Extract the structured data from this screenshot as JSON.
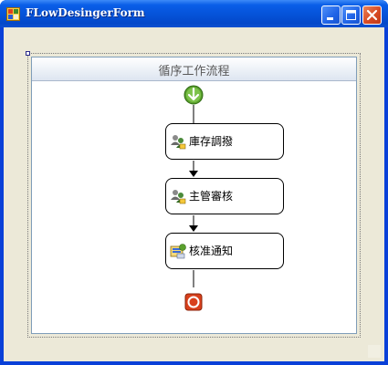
{
  "window": {
    "title": "FLowDesingerForm",
    "controls": [
      "minimize-icon",
      "maximize-icon",
      "close-icon"
    ]
  },
  "workflow": {
    "title": "循序工作流程",
    "activities": [
      {
        "label": "庫存調撥",
        "icon": "users-task-icon"
      },
      {
        "label": "主管審核",
        "icon": "users-task-icon"
      },
      {
        "label": "核准通知",
        "icon": "notification-icon"
      }
    ],
    "start_icon": "start-arrow-icon",
    "end_icon": "stop-icon"
  },
  "colors": {
    "titlebar": "#0552d8",
    "start": "#5aa02c",
    "stop": "#d8401c",
    "client": "#ece9d8"
  }
}
